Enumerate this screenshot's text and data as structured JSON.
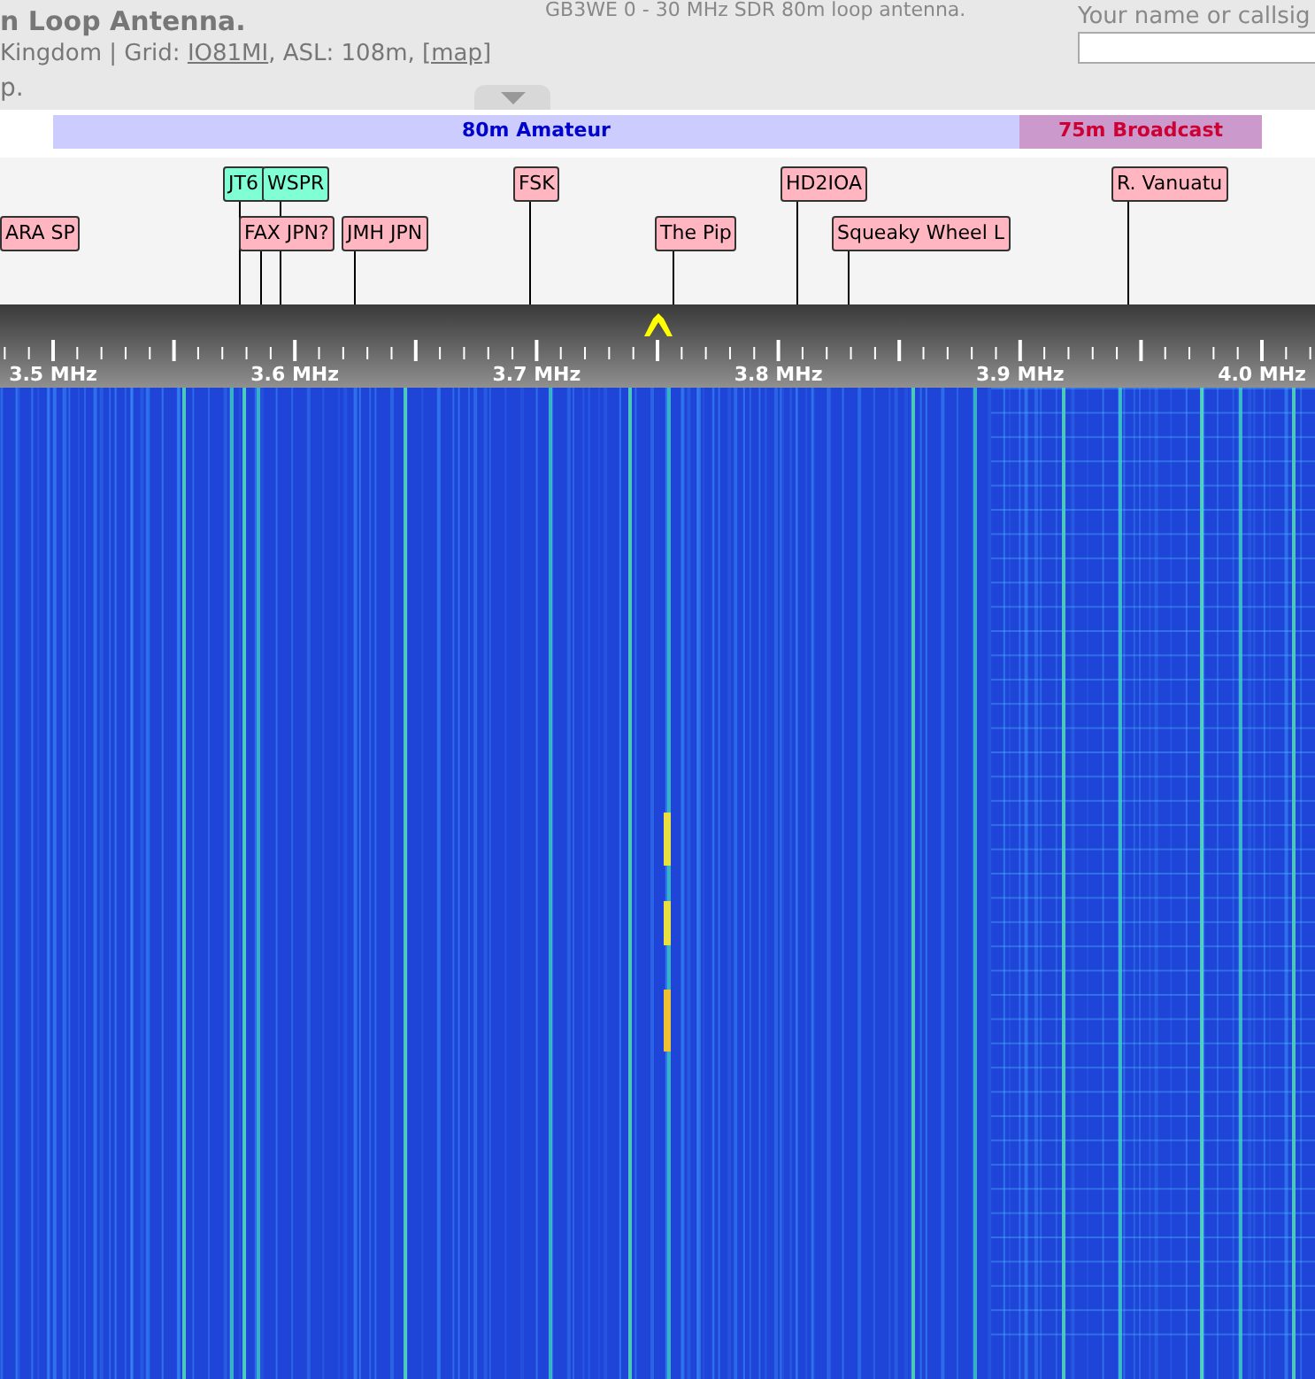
{
  "header": {
    "title": "n Loop Antenna.",
    "location_prefix": "Kingdom | Grid: ",
    "grid_link": "IO81MI",
    "location_middle": ", ASL: 108m, ",
    "map_link": "[map]",
    "note": "p.",
    "description": "GB3WE 0 - 30 MHz SDR 80m loop antenna.",
    "callsign_label": "Your name or callsig"
  },
  "bands": [
    {
      "label": "80m Amateur",
      "kind": "amateur"
    },
    {
      "label": "75m Broadcast",
      "kind": "broadcast"
    }
  ],
  "markers": [
    {
      "label": "JT6",
      "color": "#80ffd4"
    },
    {
      "label": "WSPR",
      "color": "#80ffd4"
    },
    {
      "label": "FSK",
      "color": "#ffb6c1"
    },
    {
      "label": "HD2IOA",
      "color": "#ffb6c1"
    },
    {
      "label": "R. Vanuatu",
      "color": "#ffb6c1"
    },
    {
      "label": "ARA SP",
      "color": "#ffb6c1"
    },
    {
      "label": "FAX JPN?",
      "color": "#ffb6c1"
    },
    {
      "label": "JMH JPN",
      "color": "#ffb6c1"
    },
    {
      "label": "The Pip",
      "color": "#ffb6c1"
    },
    {
      "label": "Squeaky Wheel L",
      "color": "#ffb6c1"
    }
  ],
  "scale": {
    "labels": [
      "3.5 MHz",
      "3.6 MHz",
      "3.7 MHz",
      "3.8 MHz",
      "3.9 MHz",
      "4.0 MHz"
    ]
  }
}
